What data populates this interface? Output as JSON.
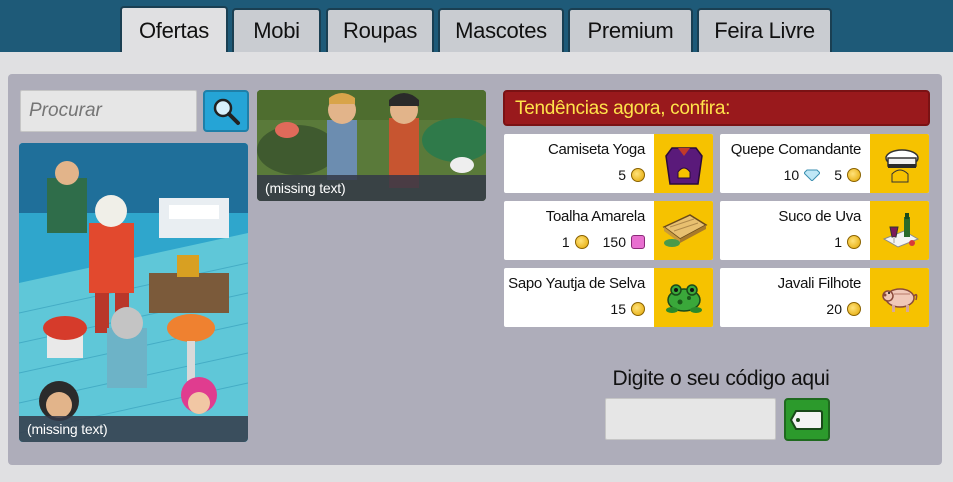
{
  "tabs": [
    {
      "label": "Ofertas",
      "active": true
    },
    {
      "label": "Mobi",
      "active": false
    },
    {
      "label": "Roupas",
      "active": false
    },
    {
      "label": "Mascotes",
      "active": false
    },
    {
      "label": "Premium",
      "active": false
    },
    {
      "label": "Feira Livre",
      "active": false
    }
  ],
  "search": {
    "placeholder": "Procurar"
  },
  "promos": {
    "big_caption": "(missing text)",
    "small_caption": "(missing text)"
  },
  "trending": {
    "title": "Tendências agora, confira:",
    "items": [
      {
        "name": "Camiseta Yoga",
        "price_1": "5",
        "price_1_currency": "coin",
        "icon": "purple-shirt-icon"
      },
      {
        "name": "Quepe Comandante",
        "price_1": "10",
        "price_1_currency": "diamond",
        "price_2": "5",
        "price_2_currency": "coin",
        "icon": "captain-hat-icon"
      },
      {
        "name": "Toalha Amarela",
        "price_1": "1",
        "price_1_currency": "coin",
        "price_2": "150",
        "price_2_currency": "pink-gem",
        "icon": "yellow-towel-icon"
      },
      {
        "name": "Suco de Uva",
        "price_1": "1",
        "price_1_currency": "coin",
        "icon": "grape-juice-icon"
      },
      {
        "name": "Sapo Yautja de Selva",
        "price_1": "15",
        "price_1_currency": "coin",
        "icon": "jungle-frog-icon"
      },
      {
        "name": "Javali Filhote",
        "price_1": "20",
        "price_1_currency": "coin",
        "icon": "baby-boar-icon"
      }
    ]
  },
  "code": {
    "label": "Digite o seu código aqui",
    "value": ""
  },
  "colors": {
    "frame_blue": "#1e5a78",
    "trending_red": "#99191c",
    "trending_text": "#ffe34a",
    "thumb_yellow": "#f6c200",
    "search_button": "#25a4d6",
    "code_button": "#2c9a2c"
  }
}
